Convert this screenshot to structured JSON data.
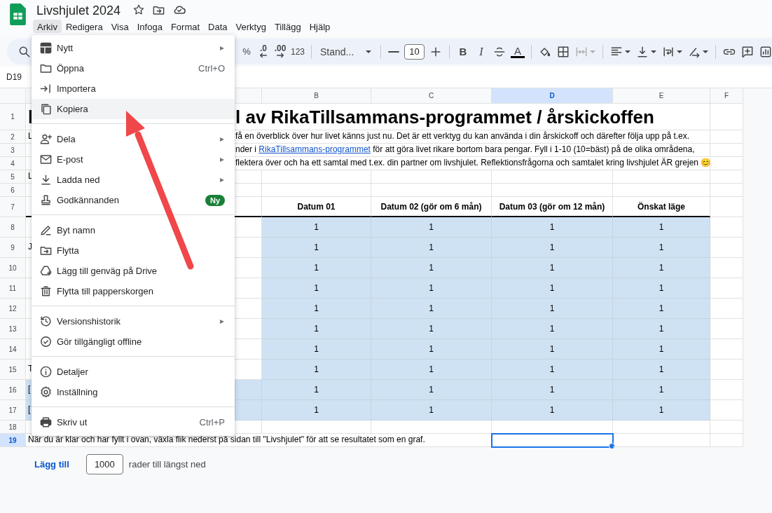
{
  "document": {
    "title": "Livshjulet 2024"
  },
  "menubar": [
    {
      "label": "Arkiv",
      "selected": true
    },
    {
      "label": "Redigera",
      "selected": false
    },
    {
      "label": "Visa",
      "selected": false
    },
    {
      "label": "Infoga",
      "selected": false
    },
    {
      "label": "Format",
      "selected": false
    },
    {
      "label": "Data",
      "selected": false
    },
    {
      "label": "Verktyg",
      "selected": false
    },
    {
      "label": "Tillägg",
      "selected": false
    },
    {
      "label": "Hjälp",
      "selected": false
    }
  ],
  "toolbar": {
    "percent": "%",
    "decrease_decimals": ".0",
    "increase_decimals": ".00",
    "more_formats": "123",
    "number_format": "Stand...",
    "font_size": "10",
    "bold": "B",
    "italic": "I",
    "text_color": "A"
  },
  "name_box": "D19",
  "file_menu": [
    {
      "kind": "item",
      "label": "Nytt",
      "submenu": true,
      "selected": false
    },
    {
      "kind": "item",
      "label": "Öppna",
      "shortcut": "Ctrl+O",
      "selected": false
    },
    {
      "kind": "item",
      "label": "Importera",
      "selected": false
    },
    {
      "kind": "item",
      "label": "Kopiera",
      "selected": true
    },
    {
      "kind": "divider"
    },
    {
      "kind": "item",
      "label": "Dela",
      "submenu": true,
      "selected": false
    },
    {
      "kind": "item",
      "label": "E-post",
      "submenu": true,
      "selected": false
    },
    {
      "kind": "item",
      "label": "Ladda ned",
      "submenu": true,
      "selected": false
    },
    {
      "kind": "item",
      "label": "Godkännanden",
      "badge": "Ny",
      "selected": false
    },
    {
      "kind": "divider"
    },
    {
      "kind": "item",
      "label": "Byt namn",
      "selected": false
    },
    {
      "kind": "item",
      "label": "Flytta",
      "selected": false
    },
    {
      "kind": "item",
      "label": "Lägg till genväg på Drive",
      "selected": false
    },
    {
      "kind": "item",
      "label": "Flytta till papperskorgen",
      "selected": false
    },
    {
      "kind": "divider"
    },
    {
      "kind": "item",
      "label": "Versionshistorik",
      "submenu": true,
      "selected": false
    },
    {
      "kind": "item",
      "label": "Gör tillgängligt offline",
      "selected": false
    },
    {
      "kind": "divider"
    },
    {
      "kind": "item",
      "label": "Detaljer",
      "selected": false
    },
    {
      "kind": "item",
      "label": "Inställning",
      "selected": false
    },
    {
      "kind": "divider"
    },
    {
      "kind": "item",
      "label": "Skriv ut",
      "shortcut": "Ctrl+P",
      "selected": false
    }
  ],
  "sheet": {
    "columns": [
      {
        "label": "B",
        "selected": false
      },
      {
        "label": "C",
        "selected": false
      },
      {
        "label": "D",
        "selected": true
      },
      {
        "label": "E",
        "selected": false
      },
      {
        "label": "F",
        "selected": false
      }
    ],
    "rows": [
      {
        "number": "1",
        "selected": false,
        "kind": "title",
        "lead": "l",
        "text": "l av RikaTillsammans-programmet / årskickoffen"
      },
      {
        "number": "2",
        "selected": false,
        "kind": "text",
        "lead": "L",
        "text": "få en överblick över hur livet känns just nu. Det är ett verktyg du kan använda i din årskickoff och därefter följa upp på t.ex."
      },
      {
        "number": "3",
        "selected": false,
        "kind": "link_text",
        "before": "nder i ",
        "link": "RikaTillsammans-programmet",
        "after": " för att göra livet rikare bortom bara pengar. Fyll i 1-10 (10=bäst) på de olika områdena,"
      },
      {
        "number": "4",
        "selected": false,
        "kind": "text",
        "text": "flektera över och ha ett samtal med t.ex. din partner om livshjulet. Reflektionsfrågorna och samtalet kring livshjulet ÄR grejen 😊"
      },
      {
        "number": "5",
        "selected": false,
        "kind": "plain",
        "lead": "L"
      },
      {
        "number": "6",
        "selected": false,
        "kind": "plain"
      },
      {
        "number": "7",
        "selected": false,
        "kind": "header",
        "cells": [
          "Datum 01",
          "Datum 02 (gör om 6 mån)",
          "Datum 03 (gör om 12 mån)",
          "Önskat läge"
        ]
      },
      {
        "number": "8",
        "selected": false,
        "kind": "values",
        "shaded": false,
        "cells": [
          "1",
          "1",
          "1",
          "1"
        ]
      },
      {
        "number": "9",
        "selected": false,
        "kind": "values",
        "lead": "J",
        "shaded": false,
        "cells": [
          "1",
          "1",
          "1",
          "1"
        ]
      },
      {
        "number": "10",
        "selected": false,
        "kind": "values",
        "shaded": false,
        "cells": [
          "1",
          "1",
          "1",
          "1"
        ]
      },
      {
        "number": "11",
        "selected": false,
        "kind": "values",
        "shaded": false,
        "cells": [
          "1",
          "1",
          "1",
          "1"
        ]
      },
      {
        "number": "12",
        "selected": false,
        "kind": "values",
        "shaded": false,
        "cells": [
          "1",
          "1",
          "1",
          "1"
        ]
      },
      {
        "number": "13",
        "selected": false,
        "kind": "values",
        "shaded": false,
        "cells": [
          "1",
          "1",
          "1",
          "1"
        ]
      },
      {
        "number": "14",
        "selected": false,
        "kind": "values",
        "shaded": false,
        "cells": [
          "1",
          "1",
          "1",
          "1"
        ]
      },
      {
        "number": "15",
        "selected": false,
        "kind": "values",
        "lead": "T",
        "shaded": false,
        "cells": [
          "1",
          "1",
          "1",
          "1"
        ]
      },
      {
        "number": "16",
        "selected": false,
        "kind": "values",
        "lead": "[",
        "shaded": true,
        "cells": [
          "1",
          "1",
          "1",
          "1"
        ]
      },
      {
        "number": "17",
        "selected": false,
        "kind": "values",
        "lead": "[",
        "shaded": true,
        "cells": [
          "1",
          "1",
          "1",
          "1"
        ]
      },
      {
        "number": "18",
        "selected": false,
        "kind": "plain"
      },
      {
        "number": "19",
        "selected": true,
        "kind": "note",
        "text": "När du är klar och har fyllt i ovan, växla flik nederst på sidan till \"Livshjulet\" för att se resultatet som en graf."
      }
    ]
  },
  "footer": {
    "add_button": "Lägg till",
    "row_count": "1000",
    "suffix": "rader till längst ned"
  }
}
